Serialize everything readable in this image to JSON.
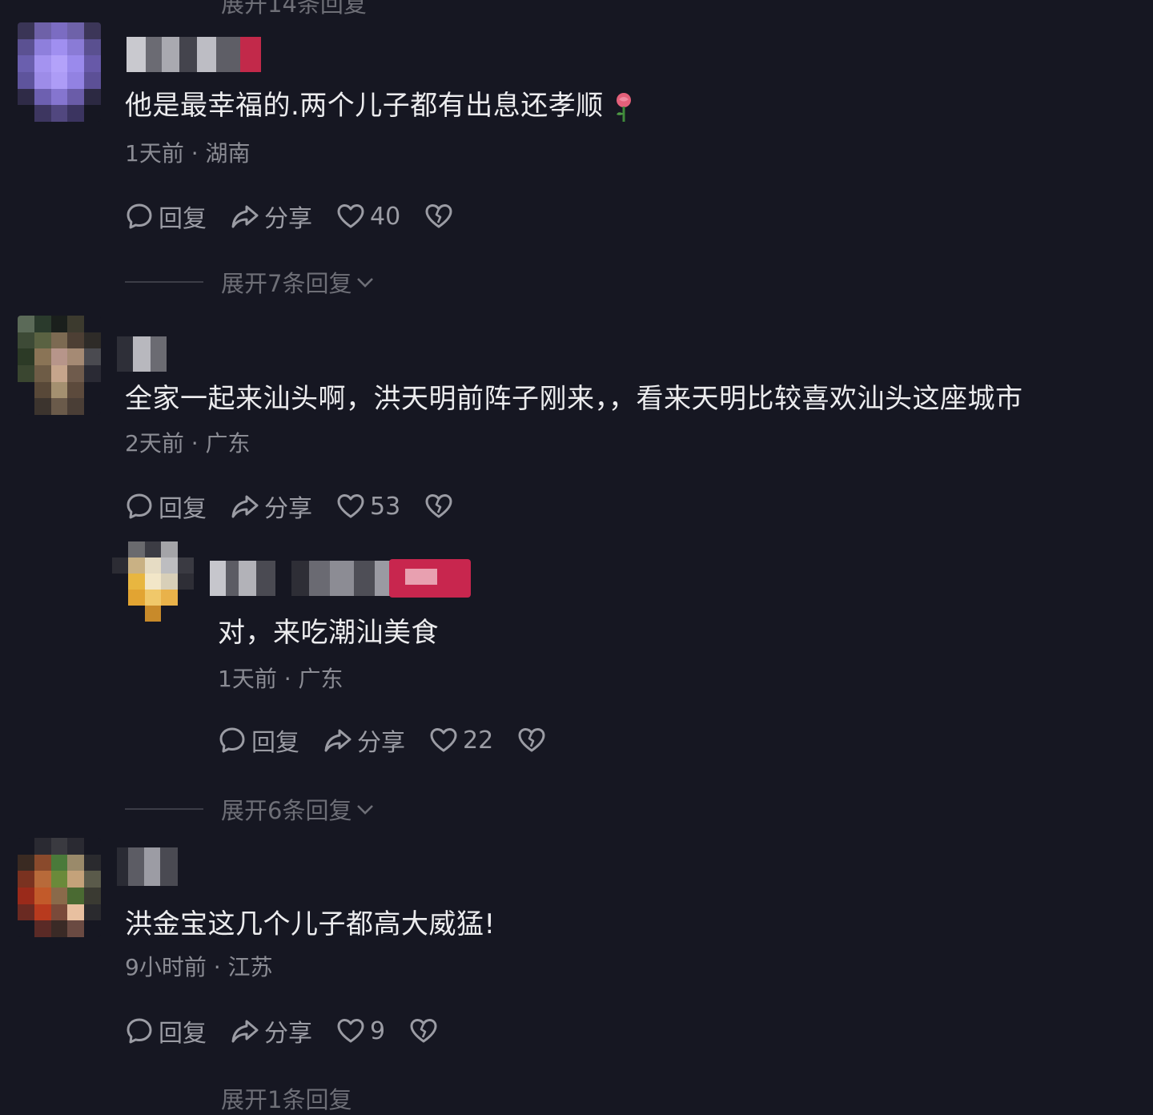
{
  "top_cutoff": "展开14条回复",
  "bottom_cutoff": "展开1条回复",
  "labels": {
    "reply": "回复",
    "share": "分享"
  },
  "colors": {
    "background": "#161722",
    "text": "#ececee",
    "meta": "#8b8c94",
    "muted": "#6e6f77"
  },
  "icons": [
    "comment-bubble-icon",
    "share-arrow-icon",
    "heart-icon",
    "broken-heart-icon",
    "chevron-down-icon",
    "rose-emoji"
  ],
  "comments": [
    {
      "text": "他是最幸福的.两个儿子都有出息还孝顺",
      "time": "1天前",
      "location": "湖南",
      "meta": "1天前 · 湖南",
      "likes": "40",
      "expand": "展开7条回复"
    },
    {
      "text": "全家一起来汕头啊，洪天明前阵子刚来，，看来天明比较喜欢汕头这座城市",
      "time": "2天前",
      "location": "广东",
      "meta": "2天前 · 广东",
      "likes": "53",
      "reply": {
        "text": "对，来吃潮汕美食",
        "time": "1天前",
        "location": "广东",
        "meta": "1天前 · 广东",
        "likes": "22"
      },
      "expand": "展开6条回复"
    },
    {
      "text": "洪金宝这几个儿子都高大威猛!",
      "time": "9小时前",
      "location": "江苏",
      "meta": "9小时前 · 江苏",
      "likes": "9"
    }
  ]
}
